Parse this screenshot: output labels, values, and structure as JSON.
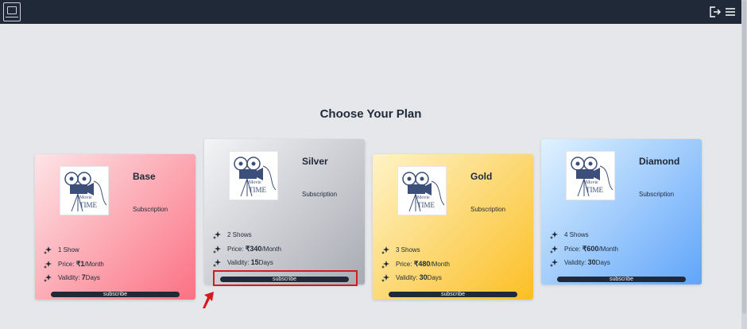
{
  "page": {
    "heading": "Choose Your Plan"
  },
  "header": {
    "logo": "movie-camera-logo",
    "icons": [
      "logout-icon",
      "menu-icon"
    ]
  },
  "plans": [
    {
      "name": "Base",
      "subtitle": "Subscription",
      "shows": "1 Show",
      "price_label": "Price:",
      "price": "₹1",
      "price_unit": "/Month",
      "validity_label": "Validity:",
      "validity_days": "7",
      "validity_unit": "Days",
      "button": "subscribe",
      "gradient": [
        "#fde4e6",
        "#fb7183"
      ]
    },
    {
      "name": "Silver",
      "subtitle": "Subscription",
      "shows": "2 Shows",
      "price_label": "Price:",
      "price": "₹340",
      "price_unit": "/Month",
      "validity_label": "Validity:",
      "validity_days": "15",
      "validity_unit": "Days",
      "button": "subscribe",
      "gradient": [
        "#f3f4f6",
        "#a9abb3"
      ]
    },
    {
      "name": "Gold",
      "subtitle": "Subscription",
      "shows": "3 Shows",
      "price_label": "Price:",
      "price": "₹480",
      "price_unit": "/Month",
      "validity_label": "Validity:",
      "validity_days": "30",
      "validity_unit": "Days",
      "button": "subscribe",
      "gradient": [
        "#fef3c7",
        "#fbbf24"
      ]
    },
    {
      "name": "Diamond",
      "subtitle": "Subscription",
      "shows": "4 Shows",
      "price_label": "Price:",
      "price": "₹600",
      "price_unit": "/Month",
      "validity_label": "Validity:",
      "validity_days": "30",
      "validity_unit": "Days",
      "button": "subscribe",
      "gradient": [
        "#e0f2fe",
        "#60a5fa"
      ]
    }
  ],
  "thumbnail_text": {
    "line1": "Movie",
    "line2": "TIME"
  },
  "colors": {
    "topbar": "#1f2937",
    "button": "#1f2937",
    "highlight": "#d71920",
    "background": "#e5e7eb"
  }
}
